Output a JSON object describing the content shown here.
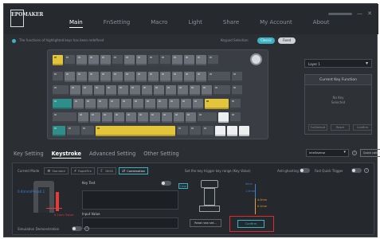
{
  "app": {
    "logo": "EPOMAKER",
    "nav": [
      "Main",
      "FnSetting",
      "Macro",
      "Light",
      "Share",
      "My Account",
      "About"
    ],
    "active_nav": "Main",
    "window_min": "—",
    "window_close": "✕"
  },
  "info": {
    "message": "The functions of highlighted keys has been redefined",
    "switch_label": "Keypad Selection",
    "pill_a": "Classic",
    "pill_b": "Fixed"
  },
  "layer": {
    "select": "Layer 1",
    "chev": "▾"
  },
  "key_function": {
    "title": "Current Key Function",
    "empty": [
      "No Key",
      "Selected"
    ],
    "buttons": [
      "Fn/Default",
      "Reset",
      "Confirm"
    ]
  },
  "tabs": [
    "Key Setting",
    "Keystroke",
    "Advanced Setting",
    "Other Setting"
  ],
  "active_tab": "Keystroke",
  "tools": {
    "select": "Intellisense",
    "chev": "▾",
    "help": "?",
    "button": "Quick calibration"
  },
  "modes": {
    "label": "Current Mode",
    "items": [
      {
        "icon": "≡",
        "label": "Standard"
      },
      {
        "icon": "⚡",
        "label": "RapidFire"
      },
      {
        "icon": "☾",
        "label": "DKSS"
      },
      {
        "icon": "⇄",
        "label": "Combination"
      }
    ],
    "active": 3,
    "trigger": "Set the key trigger key range (Key Value)",
    "anti_ghost": "Anti-ghosting",
    "fast_trigger": "Fast Quick Trigger",
    "help": "?"
  },
  "editor": {
    "key_test": "Key Test",
    "clear": "Clear",
    "input_value": "Input Value",
    "force_label": "0.4(mm)Press0.1",
    "travel_label": "0.1mm Travel",
    "simulation": "Simulation Demonstration",
    "help": "?",
    "read_button": "Read new set...",
    "confirm_button": "Confirm",
    "scale": [
      "0mm",
      "1.5mm",
      "4.0mm",
      "0.1mm"
    ]
  },
  "colors": {
    "accent": "#3bb3c3",
    "keycap_yellow": "#e2c53a",
    "keycap_teal": "#2f8e8a",
    "highlight_box": "#e02b2b"
  }
}
